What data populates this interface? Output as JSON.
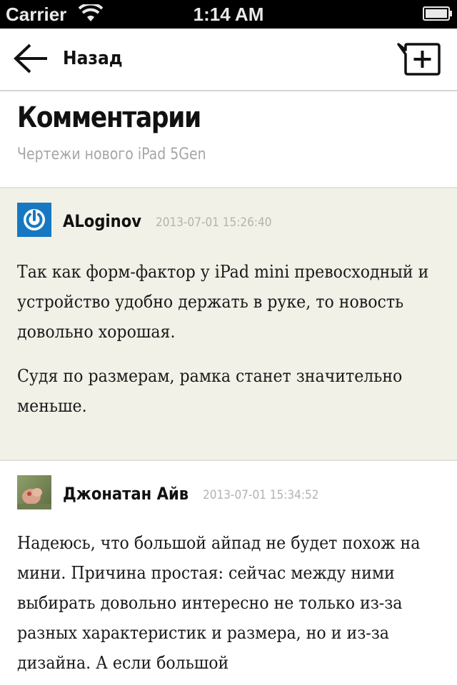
{
  "status_bar": {
    "carrier": "Carrier",
    "time": "1:14 AM",
    "icons": [
      "wifi-icon",
      "battery-icon"
    ]
  },
  "nav": {
    "back_label": "Назад",
    "back_icon": "arrow-left-icon",
    "add_comment_icon": "add-comment-icon"
  },
  "header": {
    "title": "Комментарии",
    "subtitle": "Чертежи нового iPad 5Gen"
  },
  "comments": [
    {
      "author": "ALoginov",
      "date": "2013-07-01 15:26:40",
      "avatar": "power-logo-avatar",
      "paragraphs": [
        "Так как форм-фактор у iPad mini превосходный и устройство удобно держать в руке, то новость довольно хорошая.",
        "Судя по размерам, рамка станет значительно меньше."
      ]
    },
    {
      "author": "Джонатан Айв",
      "date": "2013-07-01 15:34:52",
      "avatar": "photo-avatar",
      "paragraphs": [
        "Надеюсь, что большой айпад не будет похож на мини. Причина простая: сейчас между ними выбирать довольно интересно не только из-за разных характеристик и размера, но и из-за дизайна. А если большой"
      ]
    }
  ],
  "colors": {
    "status_bar_bg": "#000000",
    "highlight_comment_bg": "#f2f1e8",
    "date_text": "#b3b3ad",
    "subtitle_text": "#a6a6a6",
    "avatar_blue": "#1678c2"
  }
}
